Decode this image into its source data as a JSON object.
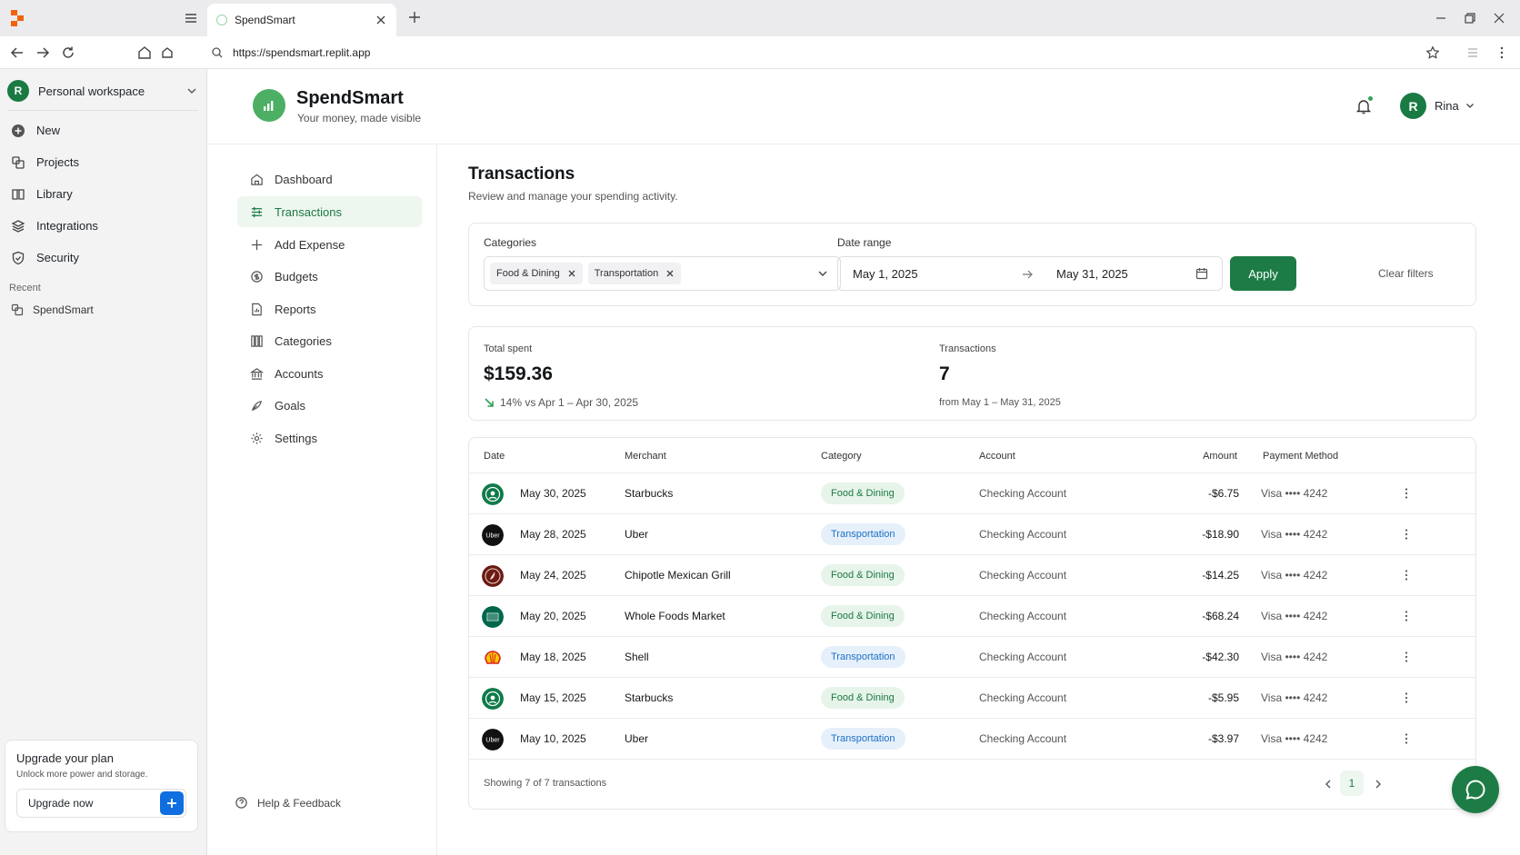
{
  "browser": {
    "tab_title": "SpendSmart",
    "url": "https://spendsmart.replit.app"
  },
  "workspace": {
    "avatar_letter": "R",
    "name": "Personal workspace",
    "nav": [
      {
        "label": "New",
        "icon": "plus-circle-icon"
      },
      {
        "label": "Projects",
        "icon": "projects-icon"
      },
      {
        "label": "Library",
        "icon": "library-icon"
      },
      {
        "label": "Integrations",
        "icon": "layers-icon"
      },
      {
        "label": "Security",
        "icon": "shield-icon"
      }
    ],
    "recent_label": "Recent",
    "recent_items": [
      "SpendSmart"
    ],
    "upgrade": {
      "title": "Upgrade your plan",
      "subtitle": "Unlock more power and storage.",
      "button_label": "Upgrade now"
    }
  },
  "app": {
    "name": "SpendSmart",
    "tagline": "Your money, made visible",
    "user": {
      "avatar_letter": "R",
      "name": "Rina"
    },
    "nav": [
      {
        "label": "Dashboard",
        "icon": "dashboard-icon"
      },
      {
        "label": "Transactions",
        "icon": "transactions-icon",
        "active": true
      },
      {
        "label": "Add Expense",
        "icon": "plus-icon"
      },
      {
        "label": "Budgets",
        "icon": "budgets-icon"
      },
      {
        "label": "Reports",
        "icon": "reports-icon"
      },
      {
        "label": "Categories",
        "icon": "categories-icon"
      },
      {
        "label": "Accounts",
        "icon": "bank-icon"
      },
      {
        "label": "Goals",
        "icon": "goals-icon"
      },
      {
        "label": "Settings",
        "icon": "gear-icon"
      }
    ],
    "help_label": "Help & Feedback"
  },
  "page": {
    "title": "Transactions",
    "subtitle": "Review and manage your spending activity."
  },
  "filters": {
    "categories_label": "Categories",
    "selected_categories": [
      "Food & Dining",
      "Transportation"
    ],
    "date_range_label": "Date range",
    "date_from": "May 1, 2025",
    "date_to": "May 31, 2025",
    "apply_label": "Apply",
    "clear_label": "Clear filters"
  },
  "stats": {
    "total_label": "Total spent",
    "total_value": "$159.36",
    "trend_text": "14%  vs Apr 1 – Apr 30, 2025",
    "trend_direction": "down",
    "count_label": "Transactions",
    "count_value": "7",
    "count_foot": "from May 1 – May 31, 2025"
  },
  "table": {
    "columns": [
      "Date",
      "Merchant",
      "Category",
      "Account",
      "Amount",
      "Payment Method"
    ],
    "rows": [
      {
        "logo": "starbucks",
        "date": "May 30, 2025",
        "merchant": "Starbucks",
        "category": "Food & Dining",
        "kind": "food",
        "account": "Checking Account",
        "amount": "-$6.75",
        "payment": "Visa •••• 4242"
      },
      {
        "logo": "uber",
        "date": "May 28, 2025",
        "merchant": "Uber",
        "category": "Transportation",
        "kind": "trans",
        "account": "Checking Account",
        "amount": "-$18.90",
        "payment": "Visa •••• 4242"
      },
      {
        "logo": "chipotle",
        "date": "May 24, 2025",
        "merchant": "Chipotle Mexican Grill",
        "category": "Food & Dining",
        "kind": "food",
        "account": "Checking Account",
        "amount": "-$14.25",
        "payment": "Visa •••• 4242"
      },
      {
        "logo": "wholefoods",
        "date": "May 20, 2025",
        "merchant": "Whole Foods Market",
        "category": "Food & Dining",
        "kind": "food",
        "account": "Checking Account",
        "amount": "-$68.24",
        "payment": "Visa •••• 4242"
      },
      {
        "logo": "shell",
        "date": "May 18, 2025",
        "merchant": "Shell",
        "category": "Transportation",
        "kind": "trans",
        "account": "Checking Account",
        "amount": "-$42.30",
        "payment": "Visa •••• 4242"
      },
      {
        "logo": "starbucks",
        "date": "May 15, 2025",
        "merchant": "Starbucks",
        "category": "Food & Dining",
        "kind": "food",
        "account": "Checking Account",
        "amount": "-$5.95",
        "payment": "Visa •••• 4242"
      },
      {
        "logo": "uber",
        "date": "May 10, 2025",
        "merchant": "Uber",
        "category": "Transportation",
        "kind": "trans",
        "account": "Checking Account",
        "amount": "-$3.97",
        "payment": "Visa •••• 4242"
      }
    ],
    "showing_text": "Showing 7 of 7 transactions",
    "current_page": "1"
  },
  "colors": {
    "brand_green": "#1d7c45",
    "food_badge_bg": "#e7f4ea",
    "transport_badge_bg": "#e5f0fb"
  }
}
